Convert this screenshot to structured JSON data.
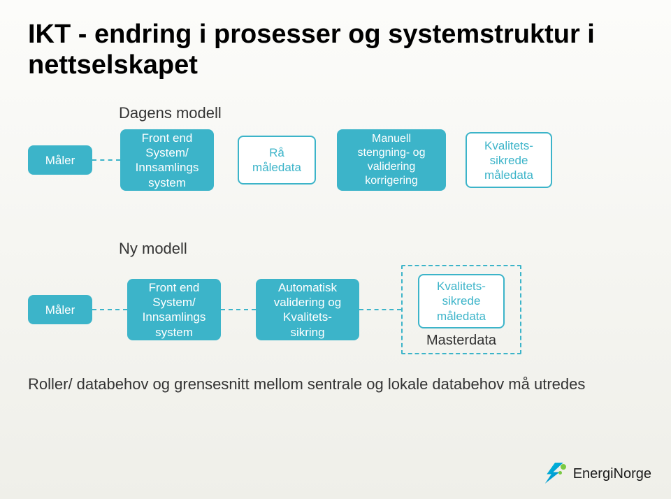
{
  "title": "IKT - endring i prosesser og systemstruktur i nettselskapet",
  "current": {
    "label": "Dagens modell",
    "maler": "Måler",
    "frontend_l1": "Front end",
    "frontend_l2": "System/",
    "frontend_l3": "Innsamlings",
    "frontend_l4": "system",
    "raa_l1": "Rå",
    "raa_l2": "måledata",
    "man_l1": "Manuell",
    "man_l2": "stengning- og",
    "man_l3": "validering",
    "man_l4": "korrigering",
    "qa_l1": "Kvalitets-",
    "qa_l2": "sikrede",
    "qa_l3": "måledata"
  },
  "new": {
    "label": "Ny modell",
    "maler": "Måler",
    "frontend_l1": "Front end",
    "frontend_l2": "System/",
    "frontend_l3": "Innsamlings",
    "frontend_l4": "system",
    "auto_l1": "Automatisk",
    "auto_l2": "validering og",
    "auto_l3": "Kvalitets-",
    "auto_l4": "sikring",
    "qa_l1": "Kvalitets-",
    "qa_l2": "sikrede",
    "qa_l3": "måledata",
    "master": "Masterdata"
  },
  "footer": "Roller/ databehov  og grensesnitt mellom sentrale og lokale databehov må utredes",
  "brand": "EnergiNorge"
}
